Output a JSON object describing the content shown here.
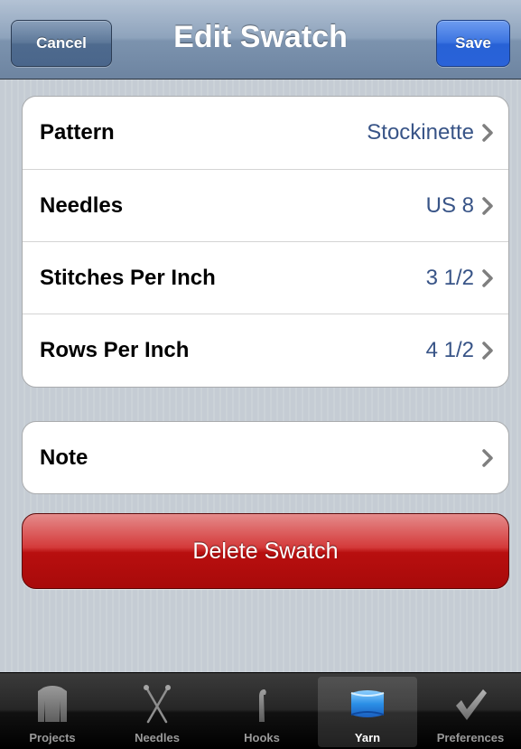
{
  "navbar": {
    "title": "Edit Swatch",
    "cancel_label": "Cancel",
    "save_label": "Save"
  },
  "swatch": {
    "rows": [
      {
        "label": "Pattern",
        "value": "Stockinette"
      },
      {
        "label": "Needles",
        "value": "US 8"
      },
      {
        "label": "Stitches Per Inch",
        "value": "3 1/2"
      },
      {
        "label": "Rows Per Inch",
        "value": "4 1/2"
      }
    ],
    "note": {
      "label": "Note",
      "value": ""
    }
  },
  "delete_label": "Delete Swatch",
  "tabbar": {
    "selected": "Yarn",
    "tabs": [
      {
        "label": "Projects",
        "icon": "sweater-icon"
      },
      {
        "label": "Needles",
        "icon": "crossed-needles-icon"
      },
      {
        "label": "Hooks",
        "icon": "crochet-hook-icon"
      },
      {
        "label": "Yarn",
        "icon": "yarn-skein-icon"
      },
      {
        "label": "Preferences",
        "icon": "checkmark-icon"
      }
    ]
  },
  "colors": {
    "value_text": "#385487",
    "delete_button": "#b80f0f",
    "save_button": "#2761d6"
  }
}
